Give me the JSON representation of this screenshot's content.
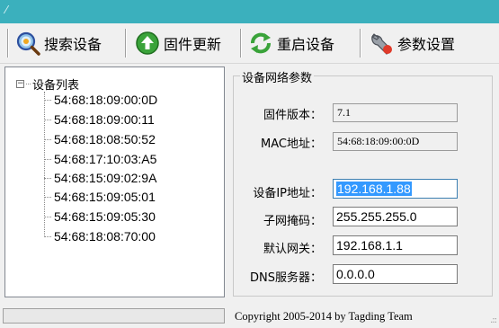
{
  "title_glyph": "⁄",
  "toolbar": {
    "search_label": "搜索设备",
    "update_label": "固件更新",
    "restart_label": "重启设备",
    "settings_label": "参数设置"
  },
  "tree": {
    "root_label": "设备列表",
    "items": [
      "54:68:18:09:00:0D",
      "54:68:18:09:00:11",
      "54:68:18:08:50:52",
      "54:68:17:10:03:A5",
      "54:68:15:09:02:9A",
      "54:68:15:09:05:01",
      "54:68:15:09:05:30",
      "54:68:18:08:70:00"
    ]
  },
  "params": {
    "group_title": "设备网络参数",
    "firmware_label": "固件版本：",
    "firmware_value": "7.1",
    "mac_label": "MAC地址：",
    "mac_value": "54:68:18:09:00:0D",
    "ip_label": "设备IP地址：",
    "ip_value": "192.168.1.88",
    "mask_label": "子网掩码：",
    "mask_value": "255.255.255.0",
    "gateway_label": "默认网关：",
    "gateway_value": "192.168.1.1",
    "dns_label": "DNS服务器：",
    "dns_value": "0.0.0.0"
  },
  "status": {
    "copyright": "Copyright 2005-2014 by Tagding Team"
  },
  "colors": {
    "titlebar": "#3bb0bd",
    "selection": "#3399ff"
  }
}
